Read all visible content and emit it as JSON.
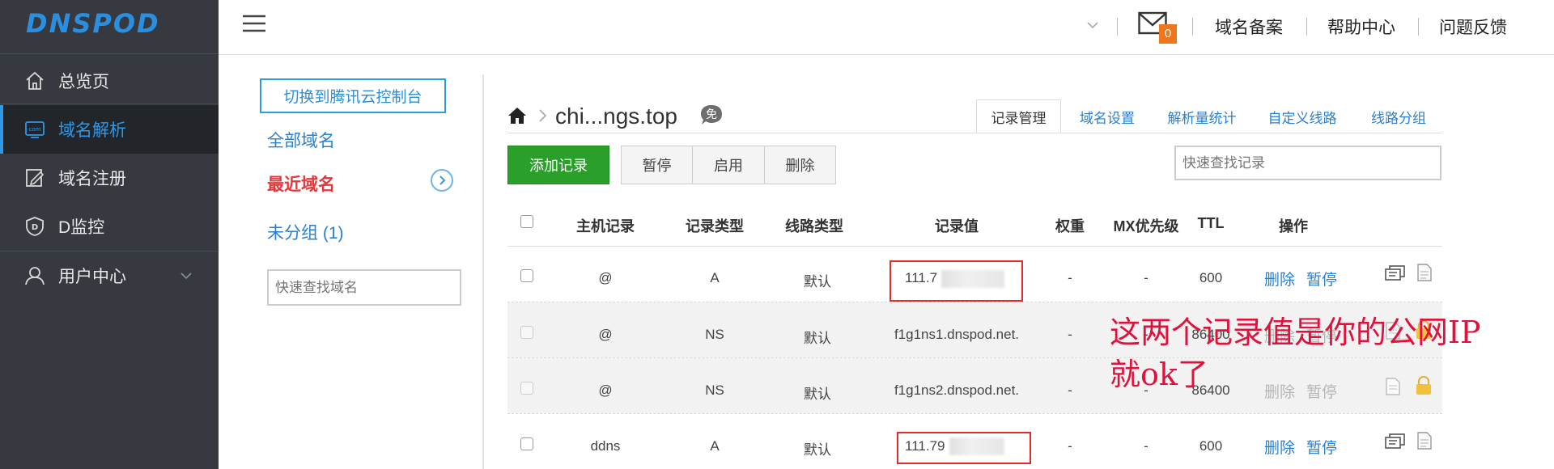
{
  "sidebar": {
    "logo": "DNSPOD",
    "items": [
      {
        "label": "总览页"
      },
      {
        "label": "域名解析"
      },
      {
        "label": "域名注册"
      },
      {
        "label": "D监控"
      },
      {
        "label": "用户中心"
      }
    ]
  },
  "topbar": {
    "mail_count": "0",
    "links": [
      "域名备案",
      "帮助中心",
      "问题反馈"
    ]
  },
  "left_panel": {
    "switch_button": "切换到腾讯云控制台",
    "all_domains": "全部域名",
    "recent_domains": "最近域名",
    "ungrouped": "未分组 (1)",
    "search_placeholder": "快速查找域名"
  },
  "domain": {
    "name": "chi...ngs.top",
    "free_badge": "免"
  },
  "tabs": [
    "记录管理",
    "域名设置",
    "解析量统计",
    "自定义线路",
    "线路分组"
  ],
  "toolbar": {
    "add": "添加记录",
    "pause": "暂停",
    "enable": "启用",
    "delete": "删除",
    "search_placeholder": "快速查找记录"
  },
  "table": {
    "headers": [
      "主机记录",
      "记录类型",
      "线路类型",
      "记录值",
      "权重",
      "MX优先级",
      "TTL",
      "操作"
    ],
    "rows": [
      {
        "host": "@",
        "type": "A",
        "line": "默认",
        "value": "111.7",
        "weight": "-",
        "mx": "-",
        "ttl": "600",
        "del": "删除",
        "pause": "暂停"
      },
      {
        "host": "@",
        "type": "NS",
        "line": "默认",
        "value": "f1g1ns1.dnspod.net.",
        "weight": "-",
        "mx": "-",
        "ttl": "86400",
        "del": "删除",
        "pause": "暂停"
      },
      {
        "host": "@",
        "type": "NS",
        "line": "默认",
        "value": "f1g1ns2.dnspod.net.",
        "weight": "-",
        "mx": "-",
        "ttl": "86400",
        "del": "删除",
        "pause": "暂停"
      },
      {
        "host": "ddns",
        "type": "A",
        "line": "默认",
        "value": "111.79",
        "weight": "-",
        "mx": "-",
        "ttl": "600",
        "del": "删除",
        "pause": "暂停"
      }
    ]
  },
  "annotation": {
    "line1": "这两个记录值是你的公网IP",
    "line2": "就ok了"
  },
  "colors": {
    "sidebar_bg": "#363a40",
    "accent_blue": "#2a7fd0",
    "add_green": "#2aa02a",
    "annotation_red": "#e0123c",
    "mail_badge": "#f0761d"
  }
}
